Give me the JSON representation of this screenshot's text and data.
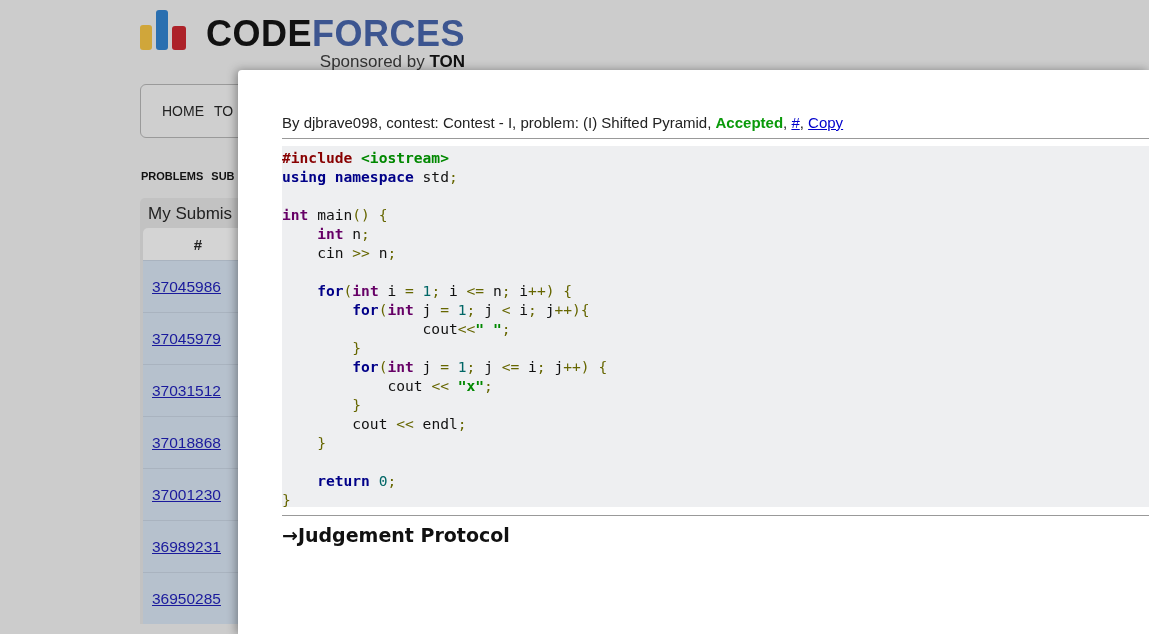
{
  "logo": {
    "first": "CODE",
    "second": "FORCES",
    "sponsor": "Sponsored by",
    "sponsor_name": "TON"
  },
  "nav": [
    "HOME",
    "TO"
  ],
  "submenu": [
    "PROBLEMS",
    "SUB"
  ],
  "submissions": {
    "title": "My Submis",
    "column": "#",
    "rows": [
      "37045986",
      "37045979",
      "37031512",
      "37018868",
      "37001230",
      "36989231",
      "36950285"
    ]
  },
  "modal": {
    "info": {
      "prefix": "By djbrave098, contest: Contest - I, problem: (I) Shifted Pyramid, ",
      "verdict": "Accepted",
      "links": [
        {
          "sep": ", ",
          "text": "#"
        },
        {
          "sep": ", ",
          "text": "Copy"
        }
      ]
    },
    "code": [
      {
        "kind": "code",
        "tokens": [
          {
            "kind": "pp",
            "text": "#include "
          },
          {
            "kind": "str",
            "text": "<iostream>"
          }
        ]
      },
      {
        "kind": "code",
        "tokens": [
          {
            "kind": "kw",
            "text": "using "
          },
          {
            "kind": "kw",
            "text": "namespace"
          },
          {
            "kind": "pln",
            "text": " std"
          },
          {
            "kind": "pun",
            "text": ";"
          }
        ]
      },
      {
        "kind": "blank"
      },
      {
        "kind": "code",
        "tokens": [
          {
            "kind": "type",
            "text": "int"
          },
          {
            "kind": "pln",
            "text": " main"
          },
          {
            "kind": "pun",
            "text": "() {"
          }
        ]
      },
      {
        "kind": "code",
        "tokens": [
          {
            "kind": "type",
            "text": "    int"
          },
          {
            "kind": "pln",
            "text": " n"
          },
          {
            "kind": "pun",
            "text": ";"
          }
        ]
      },
      {
        "kind": "code",
        "tokens": [
          {
            "kind": "pln",
            "text": "    cin "
          },
          {
            "kind": "pun",
            "text": ">>"
          },
          {
            "kind": "pln",
            "text": " n"
          },
          {
            "kind": "pun",
            "text": ";"
          }
        ]
      },
      {
        "kind": "blank"
      },
      {
        "kind": "code",
        "tokens": [
          {
            "kind": "kw",
            "text": "    for"
          },
          {
            "kind": "pun",
            "text": "("
          },
          {
            "kind": "type",
            "text": "int"
          },
          {
            "kind": "pln",
            "text": " i "
          },
          {
            "kind": "pun",
            "text": "= "
          },
          {
            "kind": "lit",
            "text": "1"
          },
          {
            "kind": "pun",
            "text": ";"
          },
          {
            "kind": "pln",
            "text": " i "
          },
          {
            "kind": "pun",
            "text": "<="
          },
          {
            "kind": "pln",
            "text": " n"
          },
          {
            "kind": "pun",
            "text": ";"
          },
          {
            "kind": "pln",
            "text": " i"
          },
          {
            "kind": "pun",
            "text": "++) {"
          }
        ]
      },
      {
        "kind": "code",
        "tokens": [
          {
            "kind": "kw",
            "text": "        for"
          },
          {
            "kind": "pun",
            "text": "("
          },
          {
            "kind": "type",
            "text": "int"
          },
          {
            "kind": "pln",
            "text": " j "
          },
          {
            "kind": "pun",
            "text": "= "
          },
          {
            "kind": "lit",
            "text": "1"
          },
          {
            "kind": "pun",
            "text": ";"
          },
          {
            "kind": "pln",
            "text": " j "
          },
          {
            "kind": "pun",
            "text": "<"
          },
          {
            "kind": "pln",
            "text": " i"
          },
          {
            "kind": "pun",
            "text": ";"
          },
          {
            "kind": "pln",
            "text": " j"
          },
          {
            "kind": "pun",
            "text": "++){"
          }
        ]
      },
      {
        "kind": "code",
        "tokens": [
          {
            "kind": "pln",
            "text": "                cout"
          },
          {
            "kind": "pun",
            "text": "<<"
          },
          {
            "kind": "str",
            "text": "\" \""
          },
          {
            "kind": "pun",
            "text": ";"
          }
        ]
      },
      {
        "kind": "code",
        "tokens": [
          {
            "kind": "pun",
            "text": "        }"
          }
        ]
      },
      {
        "kind": "code",
        "tokens": [
          {
            "kind": "kw",
            "text": "        for"
          },
          {
            "kind": "pun",
            "text": "("
          },
          {
            "kind": "type",
            "text": "int"
          },
          {
            "kind": "pln",
            "text": " j "
          },
          {
            "kind": "pun",
            "text": "= "
          },
          {
            "kind": "lit",
            "text": "1"
          },
          {
            "kind": "pun",
            "text": ";"
          },
          {
            "kind": "pln",
            "text": " j "
          },
          {
            "kind": "pun",
            "text": "<="
          },
          {
            "kind": "pln",
            "text": " i"
          },
          {
            "kind": "pun",
            "text": ";"
          },
          {
            "kind": "pln",
            "text": " j"
          },
          {
            "kind": "pun",
            "text": "++) {"
          }
        ]
      },
      {
        "kind": "code",
        "tokens": [
          {
            "kind": "pln",
            "text": "            cout "
          },
          {
            "kind": "pun",
            "text": "<< "
          },
          {
            "kind": "str",
            "text": "\"x\""
          },
          {
            "kind": "pun",
            "text": ";"
          }
        ]
      },
      {
        "kind": "code",
        "tokens": [
          {
            "kind": "pun",
            "text": "        }"
          }
        ]
      },
      {
        "kind": "code",
        "tokens": [
          {
            "kind": "pln",
            "text": "        cout "
          },
          {
            "kind": "pun",
            "text": "<<"
          },
          {
            "kind": "pln",
            "text": " endl"
          },
          {
            "kind": "pun",
            "text": ";"
          }
        ]
      },
      {
        "kind": "code",
        "tokens": [
          {
            "kind": "pun",
            "text": "    }"
          }
        ]
      },
      {
        "kind": "blank"
      },
      {
        "kind": "code",
        "tokens": [
          {
            "kind": "kw",
            "text": "    return "
          },
          {
            "kind": "lit",
            "text": "0"
          },
          {
            "kind": "pun",
            "text": ";"
          }
        ]
      },
      {
        "kind": "code",
        "tokens": [
          {
            "kind": "pun",
            "text": "}"
          }
        ]
      }
    ],
    "protocol": "→Judgement Protocol"
  }
}
